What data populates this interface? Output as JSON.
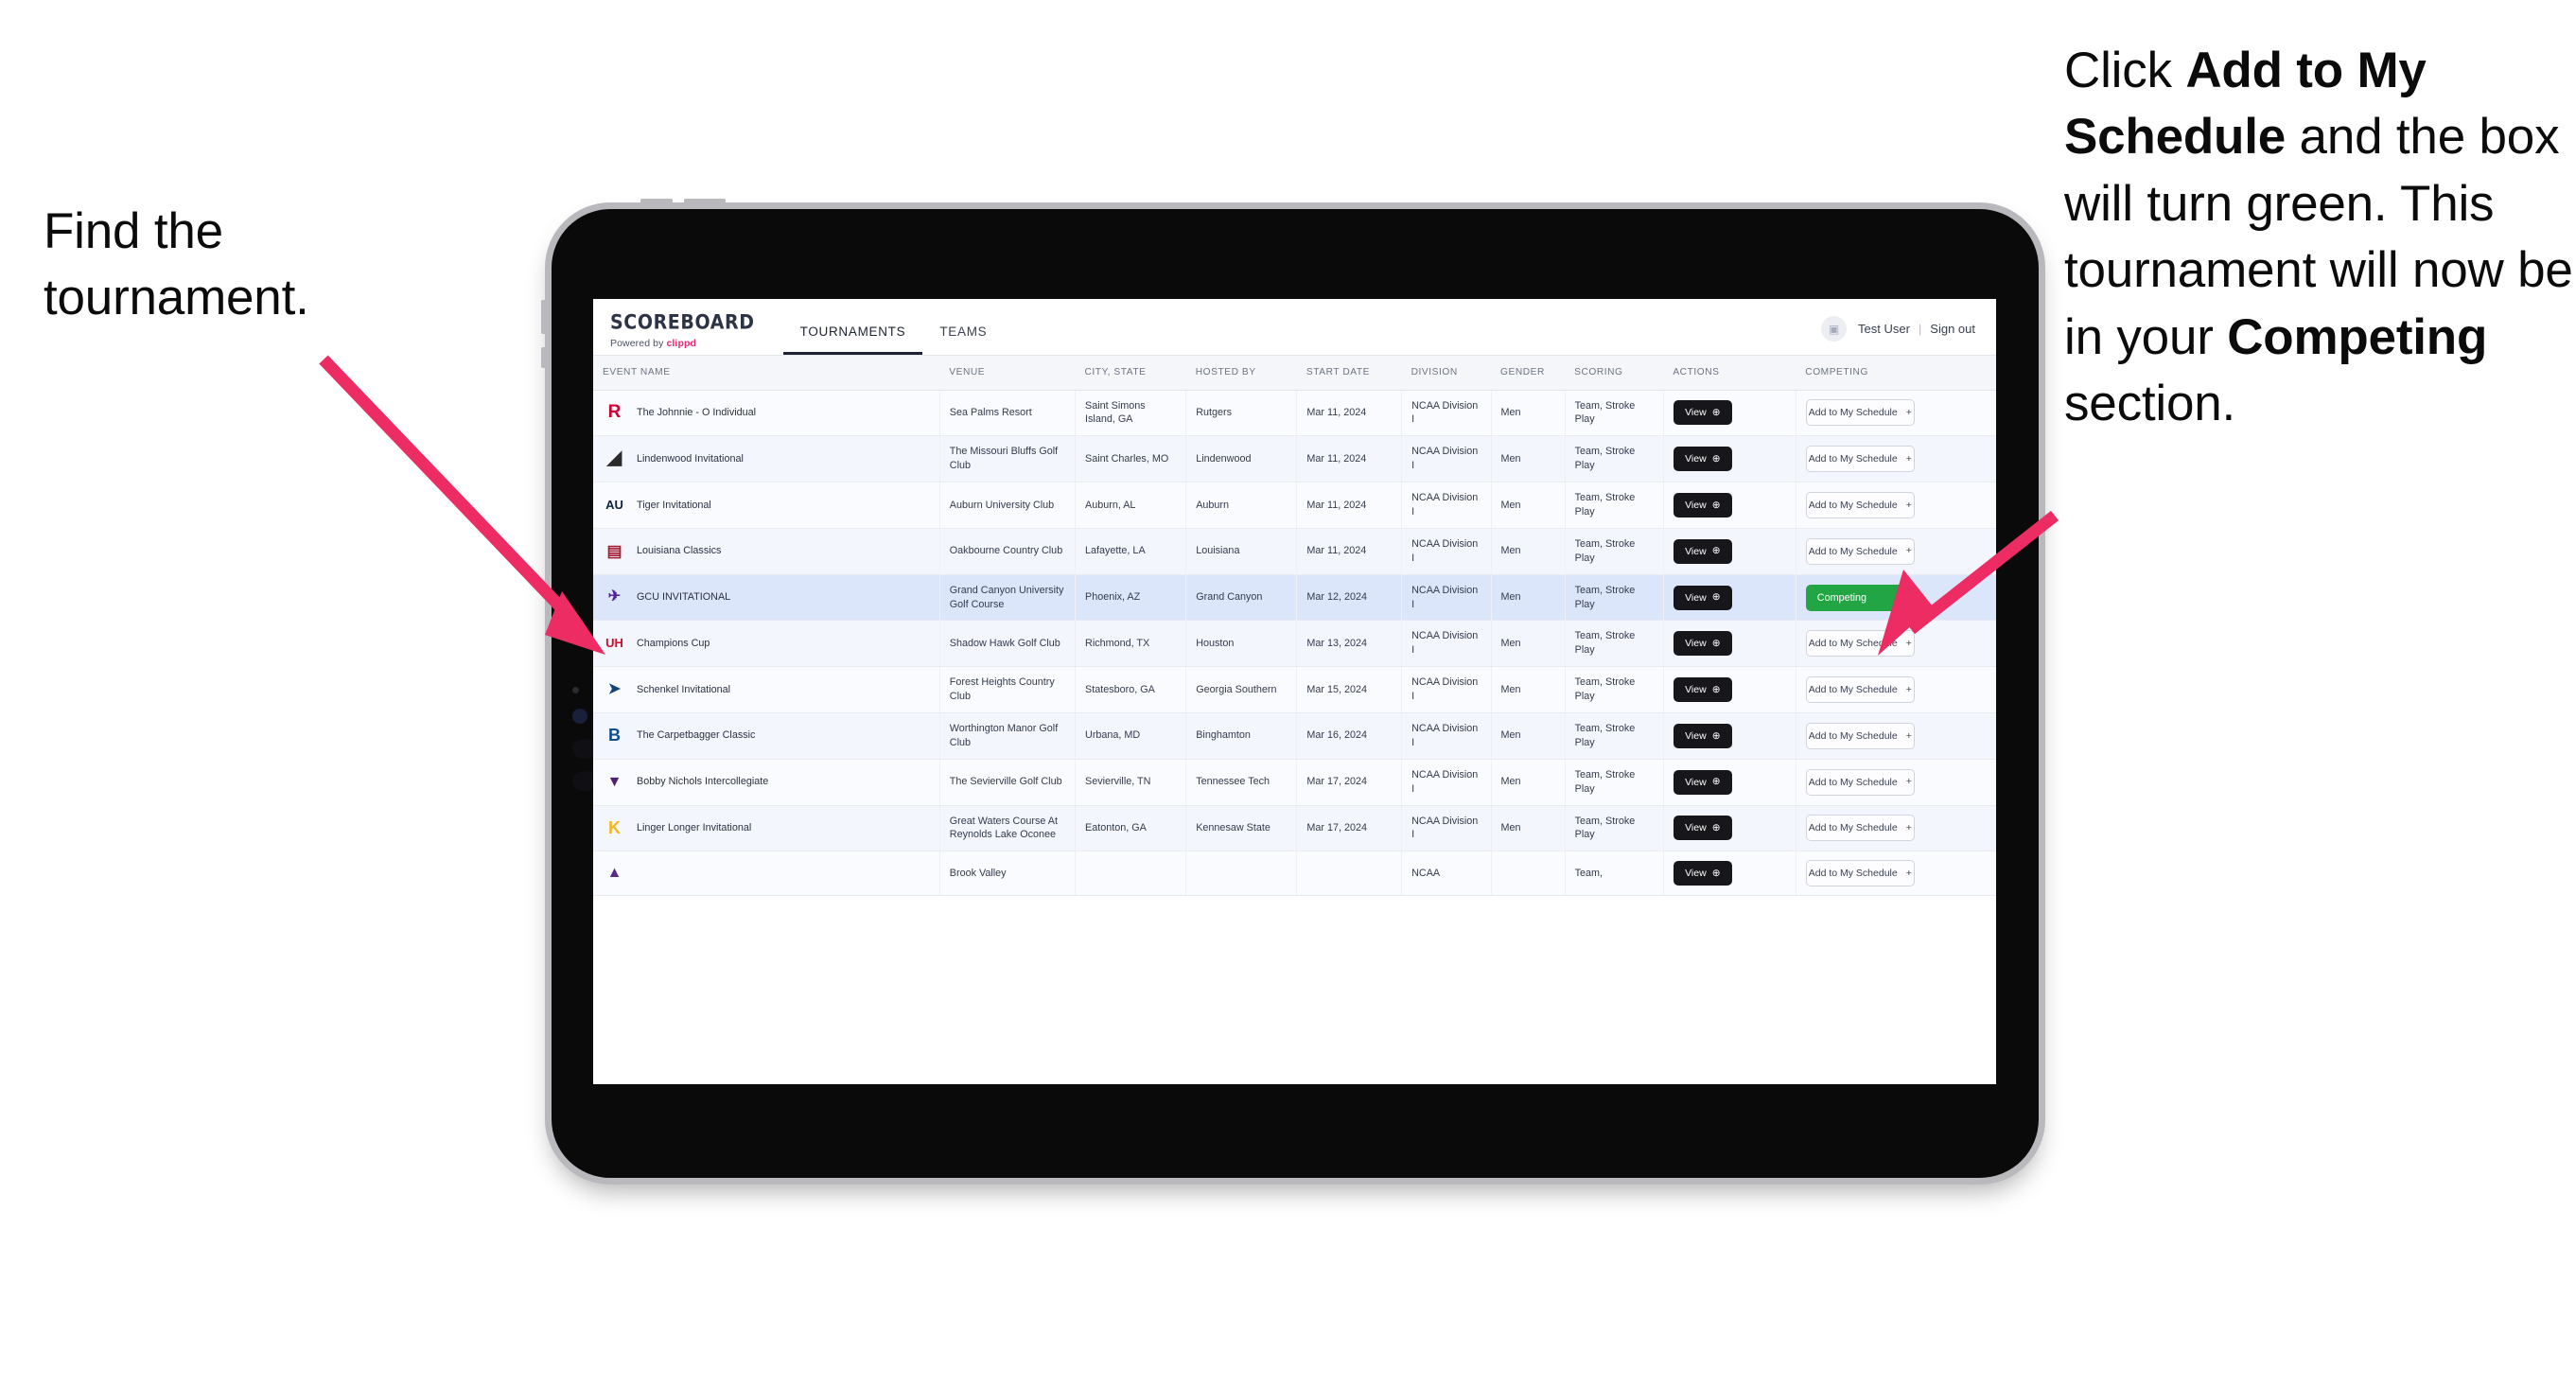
{
  "annotations": {
    "left": {
      "text": "Find the tournament."
    },
    "right": {
      "part1": "Click ",
      "bold1": "Add to My Schedule",
      "part2": " and the box will turn green. This tournament will now be in your ",
      "bold2": "Competing",
      "part3": " section."
    },
    "arrow_color": "#ED2C63"
  },
  "app": {
    "brand": {
      "title": "SCOREBOARD",
      "powered_prefix": "Powered by ",
      "powered_name": "clippd"
    },
    "nav": [
      {
        "label": "TOURNAMENTS",
        "active": true
      },
      {
        "label": "TEAMS",
        "active": false
      }
    ],
    "header_right": {
      "avatar_icon": "user-avatar-icon",
      "user_name": "Test User",
      "separator": "|",
      "sign_out": "Sign out"
    },
    "table": {
      "columns": [
        "EVENT NAME",
        "VENUE",
        "CITY, STATE",
        "HOSTED BY",
        "START DATE",
        "DIVISION",
        "GENDER",
        "SCORING",
        "ACTIONS",
        "COMPETING"
      ],
      "view_label": "View",
      "add_label": "Add to My Schedule",
      "add_icon": "plus-icon",
      "view_icon": "arrow-right-circle-icon",
      "competing_label": "Competing",
      "competing_icon": "check-icon",
      "competing_color": "#22A544",
      "rows": [
        {
          "logo": "rutgers-logo",
          "name": "The Johnnie - O Individual",
          "venue": "Sea Palms Resort",
          "city": "Saint Simons Island, GA",
          "host": "Rutgers",
          "date": "Mar 11, 2024",
          "division": "NCAA Division I",
          "gender": "Men",
          "scoring": "Team, Stroke Play",
          "competing": false
        },
        {
          "logo": "lindenwood-logo",
          "name": "Lindenwood Invitational",
          "venue": "The Missouri Bluffs Golf Club",
          "city": "Saint Charles, MO",
          "host": "Lindenwood",
          "date": "Mar 11, 2024",
          "division": "NCAA Division I",
          "gender": "Men",
          "scoring": "Team, Stroke Play",
          "competing": false
        },
        {
          "logo": "auburn-logo",
          "name": "Tiger Invitational",
          "venue": "Auburn University Club",
          "city": "Auburn, AL",
          "host": "Auburn",
          "date": "Mar 11, 2024",
          "division": "NCAA Division I",
          "gender": "Men",
          "scoring": "Team, Stroke Play",
          "competing": false
        },
        {
          "logo": "louisiana-logo",
          "name": "Louisiana Classics",
          "venue": "Oakbourne Country Club",
          "city": "Lafayette, LA",
          "host": "Louisiana",
          "date": "Mar 11, 2024",
          "division": "NCAA Division I",
          "gender": "Men",
          "scoring": "Team, Stroke Play",
          "competing": false
        },
        {
          "logo": "grand-canyon-logo",
          "name": "GCU INVITATIONAL",
          "venue": "Grand Canyon University Golf Course",
          "city": "Phoenix, AZ",
          "host": "Grand Canyon",
          "date": "Mar 12, 2024",
          "division": "NCAA Division I",
          "gender": "Men",
          "scoring": "Team, Stroke Play",
          "competing": true,
          "selected": true
        },
        {
          "logo": "houston-logo",
          "name": "Champions Cup",
          "venue": "Shadow Hawk Golf Club",
          "city": "Richmond, TX",
          "host": "Houston",
          "date": "Mar 13, 2024",
          "division": "NCAA Division I",
          "gender": "Men",
          "scoring": "Team, Stroke Play",
          "competing": false
        },
        {
          "logo": "georgia-southern-logo",
          "name": "Schenkel Invitational",
          "venue": "Forest Heights Country Club",
          "city": "Statesboro, GA",
          "host": "Georgia Southern",
          "date": "Mar 15, 2024",
          "division": "NCAA Division I",
          "gender": "Men",
          "scoring": "Team, Stroke Play",
          "competing": false
        },
        {
          "logo": "binghamton-logo",
          "name": "The Carpetbagger Classic",
          "venue": "Worthington Manor Golf Club",
          "city": "Urbana, MD",
          "host": "Binghamton",
          "date": "Mar 16, 2024",
          "division": "NCAA Division I",
          "gender": "Men",
          "scoring": "Team, Stroke Play",
          "competing": false
        },
        {
          "logo": "tennessee-tech-logo",
          "name": "Bobby Nichols Intercollegiate",
          "venue": "The Sevierville Golf Club",
          "city": "Sevierville, TN",
          "host": "Tennessee Tech",
          "date": "Mar 17, 2024",
          "division": "NCAA Division I",
          "gender": "Men",
          "scoring": "Team, Stroke Play",
          "competing": false
        },
        {
          "logo": "kennesaw-state-logo",
          "name": "Linger Longer Invitational",
          "venue": "Great Waters Course At Reynolds Lake Oconee",
          "city": "Eatonton, GA",
          "host": "Kennesaw State",
          "date": "Mar 17, 2024",
          "division": "NCAA Division I",
          "gender": "Men",
          "scoring": "Team, Stroke Play",
          "competing": false
        },
        {
          "logo": "east-carolina-logo",
          "name": "",
          "venue": "Brook Valley",
          "city": "",
          "host": "",
          "date": "",
          "division": "NCAA",
          "gender": "",
          "scoring": "Team,",
          "competing": false,
          "partial": true
        }
      ]
    }
  }
}
